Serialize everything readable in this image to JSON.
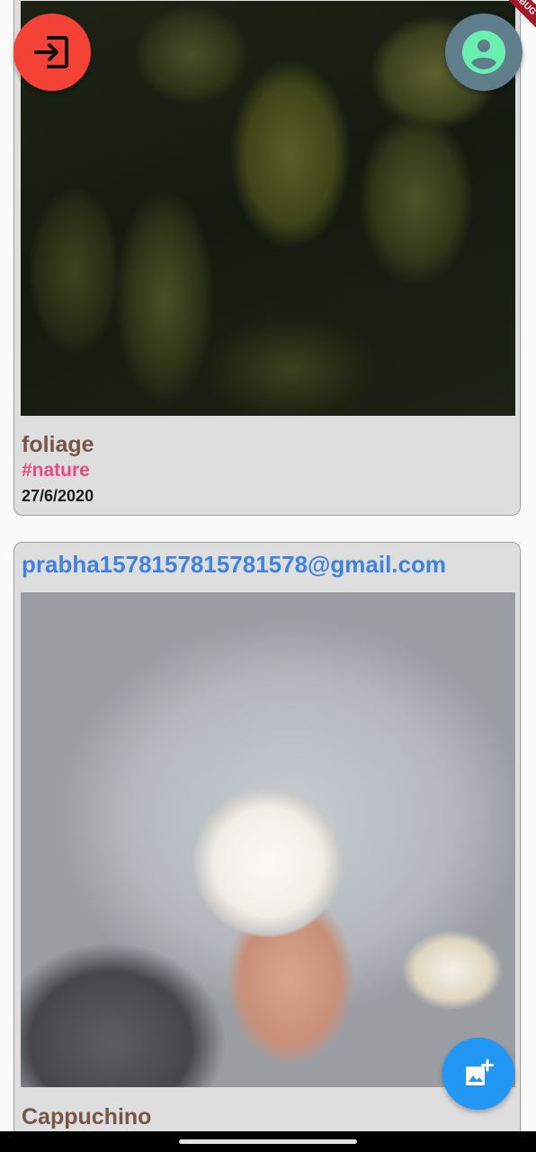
{
  "posts": [
    {
      "title": "foliage",
      "tag": "#nature",
      "date": "27/6/2020",
      "image": "water-drops-on-leaves-photo"
    },
    {
      "email": "prabha1578157815781578@gmail.com",
      "title": "Cappuchino",
      "image": "yogurt-granola-bowl-photo"
    }
  ],
  "buttons": {
    "logout_icon": "logout-icon",
    "profile_icon": "account-circle-icon",
    "add_post_icon": "add-photo-icon"
  },
  "debug_banner": "DEBUG",
  "colors": {
    "logout_fab": "#f44336",
    "profile_fab": "#607d8b",
    "add_fab": "#2196f3",
    "title": "#795548",
    "tag": "#e94a84",
    "email": "#3f82e0",
    "card": "#dedede"
  }
}
